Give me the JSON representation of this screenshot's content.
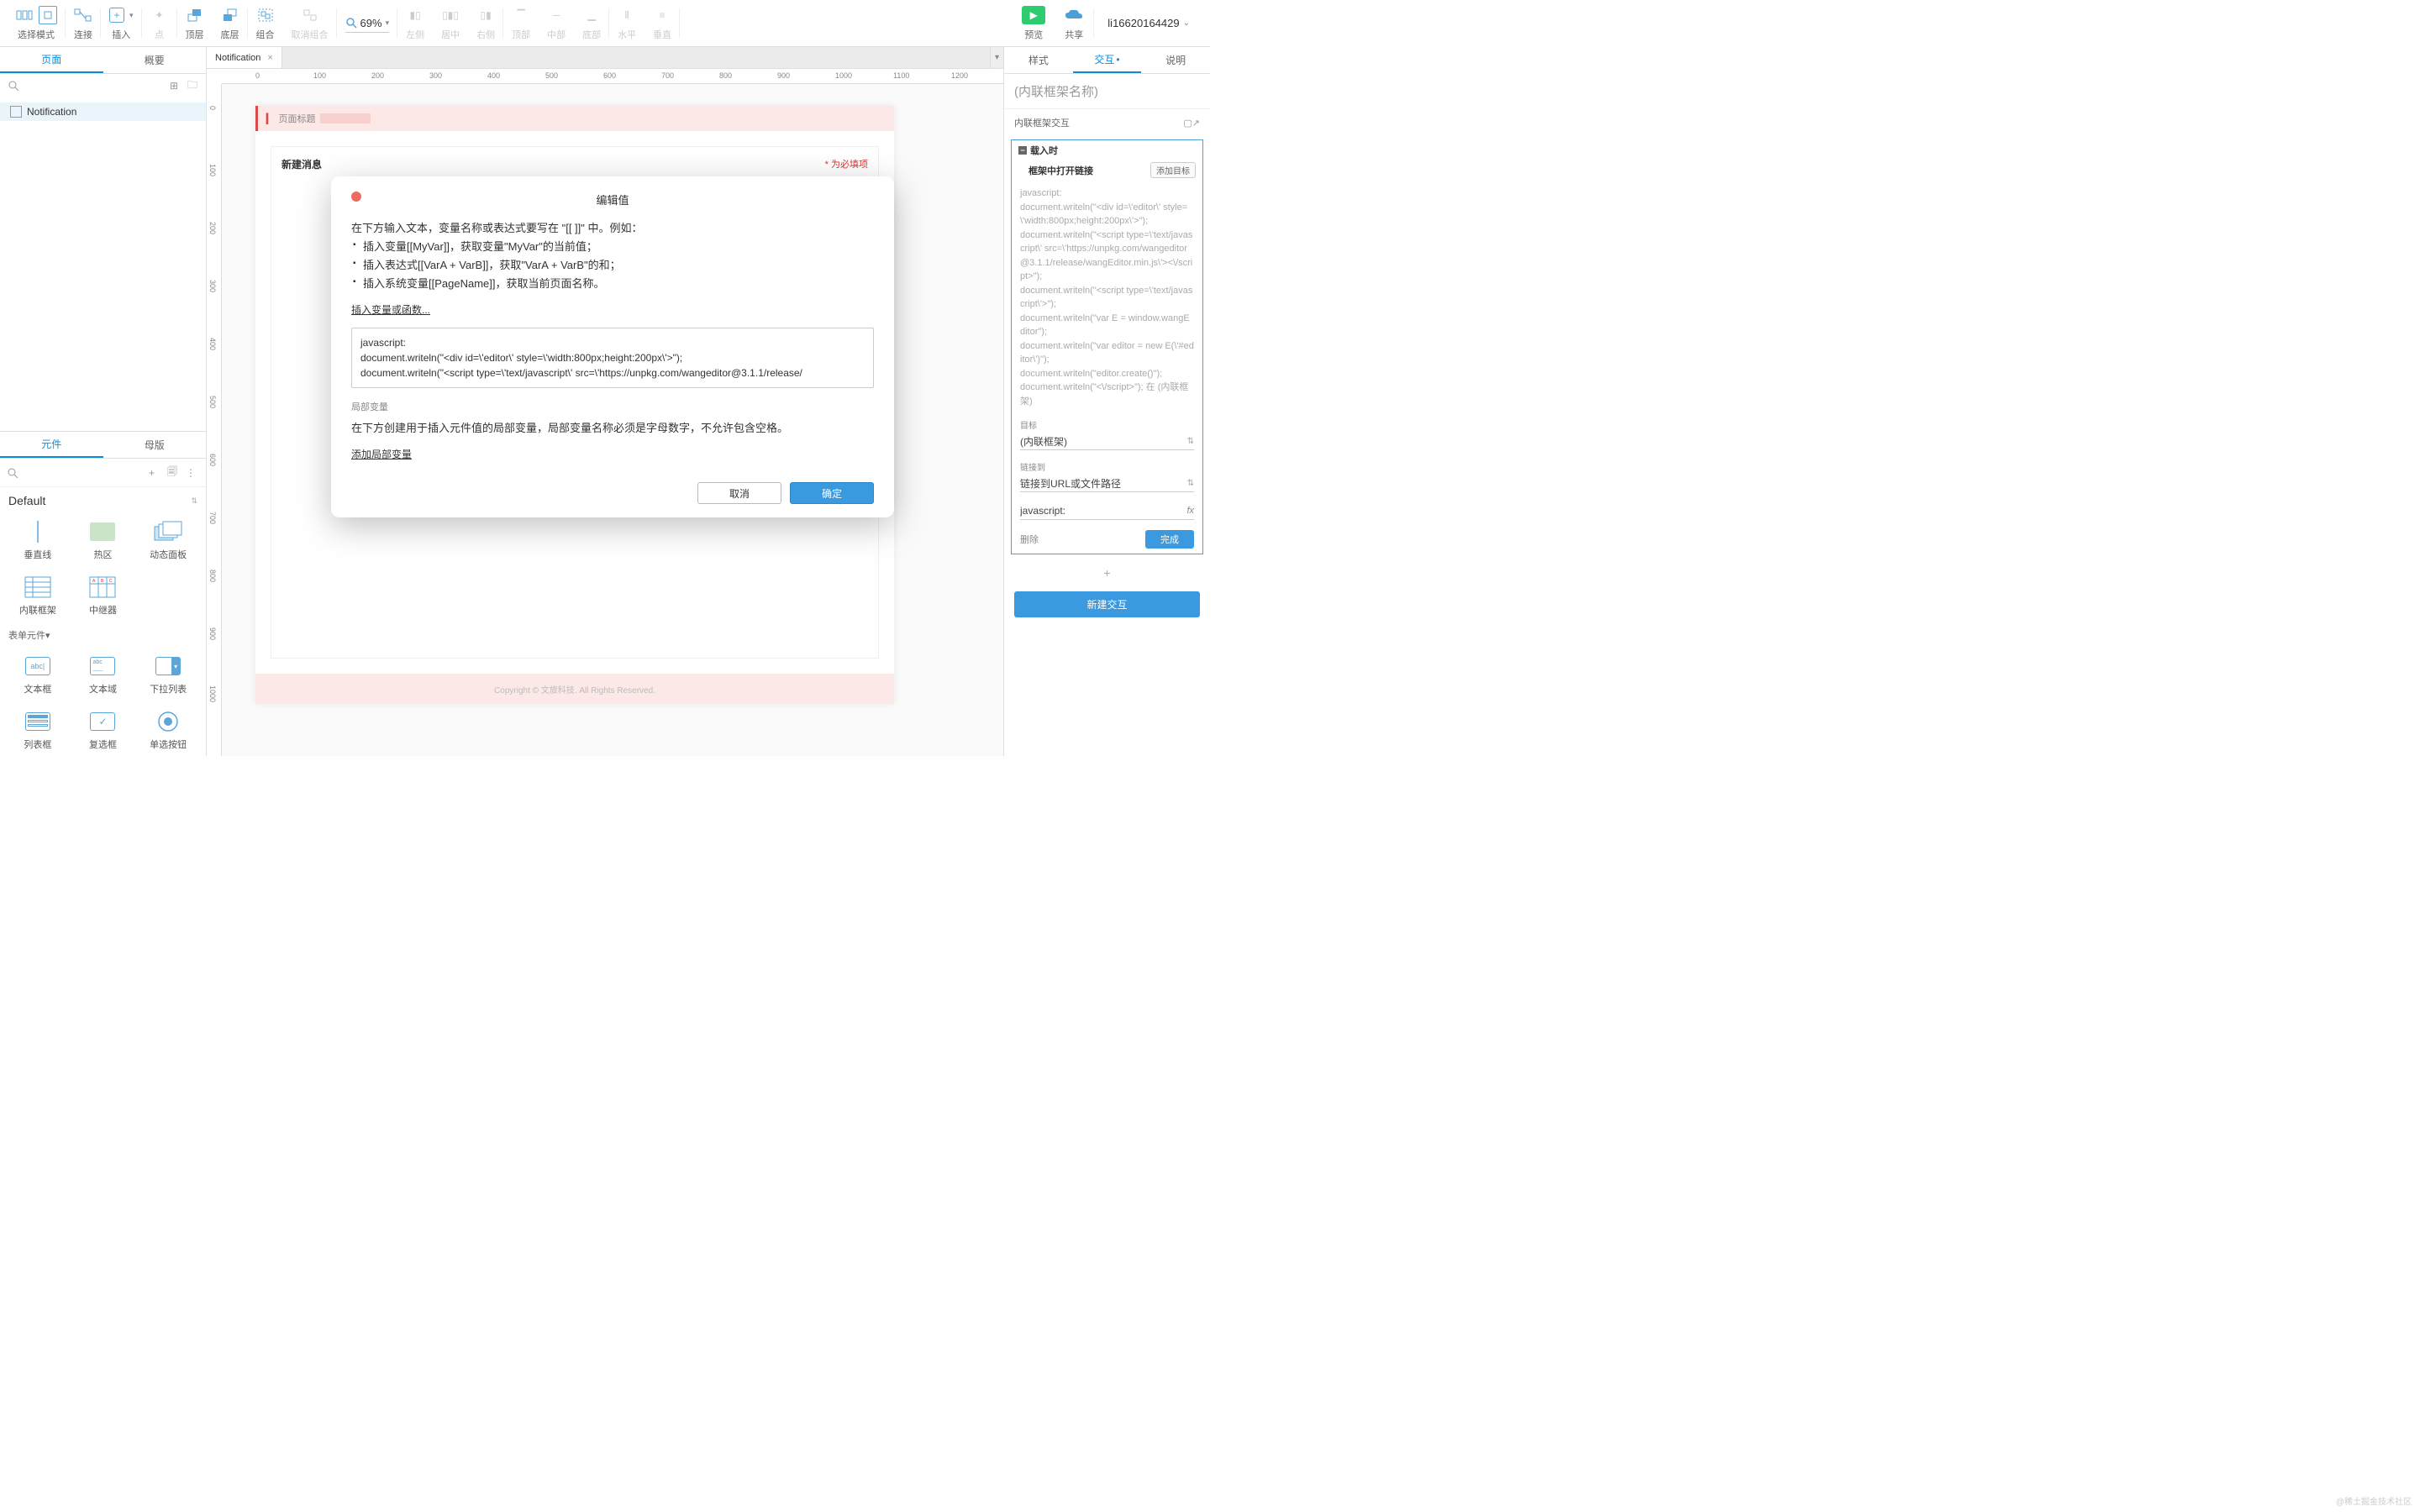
{
  "toolbar": {
    "select_mode": "选择模式",
    "connect": "连接",
    "insert": "插入",
    "point": "点",
    "top_layer": "顶层",
    "bottom_layer": "底层",
    "group": "组合",
    "ungroup": "取消组合",
    "zoom_value": "69%",
    "left": "左侧",
    "center_h": "居中",
    "right": "右侧",
    "top": "顶部",
    "middle": "中部",
    "bottom": "底部",
    "dist_h": "水平",
    "dist_v": "垂直",
    "preview": "预览",
    "share": "共享",
    "account": "li16620164429"
  },
  "left": {
    "tab_pages": "页面",
    "tab_outline": "概要",
    "page_name": "Notification",
    "tab_widgets": "元件",
    "tab_masters": "母版",
    "lib_default": "Default",
    "w_vline": "垂直线",
    "w_hotspot": "热区",
    "w_dynamic": "动态面板",
    "w_iframe": "内联框架",
    "w_repeater": "中继器",
    "form_section": "表单元件▾",
    "w_textfield": "文本框",
    "w_textarea": "文本域",
    "w_dropdown": "下拉列表",
    "w_listbox": "列表框",
    "w_checkbox": "复选框",
    "w_radio": "单选按钮"
  },
  "canvas": {
    "tab_name": "Notification",
    "ruler_h": [
      "0",
      "100",
      "200",
      "300",
      "400",
      "500",
      "600",
      "700",
      "800",
      "900",
      "1000",
      "1100",
      "1200"
    ],
    "ruler_v": [
      "0",
      "100",
      "200",
      "300",
      "400",
      "500",
      "600",
      "700",
      "800",
      "900",
      "1000"
    ],
    "page_title_label": "页面标题",
    "msg_title": "新建消息",
    "required_note": "* 为必填项",
    "footer": "Copyright © 文旅科技. All Rights Reserved."
  },
  "modal": {
    "title": "编辑值",
    "intro": "在下方输入文本，变量名称或表达式要写在 \"[[ ]]\" 中。例如：",
    "b1": "插入变量[[MyVar]]，获取变量\"MyVar\"的当前值；",
    "b2": "插入表达式[[VarA + VarB]]，获取\"VarA + VarB\"的和；",
    "b3": "插入系统变量[[PageName]]，获取当前页面名称。",
    "insert_link": "插入变量或函数...",
    "code": "javascript:\ndocument.writeln(\"<div id=\\'editor\\' style=\\'width:800px;height:200px\\'>\");\ndocument.writeln(\"<script type=\\'text/javascript\\' src=\\'https://unpkg.com/wangeditor@3.1.1/release/",
    "local_label": "局部变量",
    "local_desc": "在下方创建用于插入元件值的局部变量，局部变量名称必须是字母数字，不允许包含空格。",
    "add_local": "添加局部变量",
    "cancel": "取消",
    "ok": "确定"
  },
  "right": {
    "tab_style": "样式",
    "tab_interact": "交互",
    "tab_notes": "说明",
    "widget_name": "(内联框架名称)",
    "sect_title": "内联框架交互",
    "event_name": "载入时",
    "action_name": "框架中打开链接",
    "add_target": "添加目标",
    "code_summary": "javascript:\ndocument.writeln(\"<div id=\\'editor\\' style=\\'width:800px;height:200px\\'>\");\ndocument.writeln(\"<script type=\\'text/javascript\\' src=\\'https://unpkg.com/wangeditor@3.1.1/release/wangEditor.min.js\\'><\\/script>\");\ndocument.writeln(\"<script type=\\'text/javascript\\'>\");\ndocument.writeln(\"var E = window.wangEditor\");\ndocument.writeln(\"var editor = new E(\\'#editor\\')\");\ndocument.writeln(\"editor.create()\");\ndocument.writeln(\"<\\/script>\"); 在 (内联框架)",
    "target_label": "目标",
    "target_value": "(内联框架)",
    "linkto_label": "链接到",
    "linkto_value": "链接到URL或文件路径",
    "url_value": "javascript:",
    "delete": "删除",
    "done": "完成",
    "new_interaction": "新建交互",
    "watermark": "@稀土掘金技术社区"
  }
}
